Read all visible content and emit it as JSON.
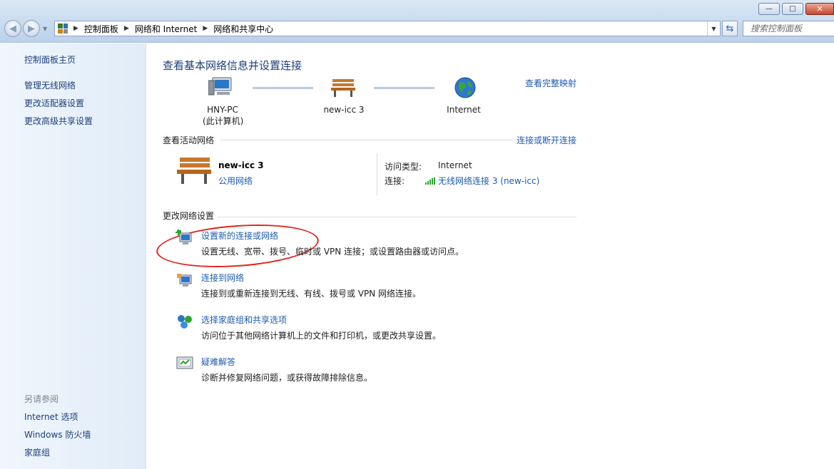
{
  "window": {
    "minimize_glyph": "—",
    "maximize_glyph": "□",
    "close_glyph": "✕"
  },
  "address_bar": {
    "crumbs": [
      "控制面板",
      "网络和 Internet",
      "网络和共享中心"
    ],
    "search_placeholder": "搜索控制面板"
  },
  "sidebar": {
    "home": "控制面板主页",
    "links": [
      "管理无线网络",
      "更改适配器设置",
      "更改高级共享设置"
    ],
    "see_also_title": "另请参阅",
    "see_also": [
      "Internet 选项",
      "Windows 防火墙",
      "家庭组"
    ]
  },
  "main": {
    "title": "查看基本网络信息并设置连接",
    "full_map_link": "查看完整映射",
    "map": {
      "computer_name": "HNY-PC",
      "computer_sub": "(此计算机)",
      "network_name": "new-icc  3",
      "internet_label": "Internet"
    },
    "active_networks": {
      "title": "查看活动网络",
      "connect_link": "连接或断开连接",
      "network_name": "new-icc  3",
      "network_type": "公用网络",
      "access_type_label": "访问类型:",
      "access_type_value": "Internet",
      "connection_label": "连接:",
      "connection_value": "无线网络连接 3 (new-icc)"
    },
    "change_settings": {
      "title": "更改网络设置",
      "tasks": [
        {
          "title": "设置新的连接或网络",
          "desc": "设置无线、宽带、拨号、临时或 VPN 连接；或设置路由器或访问点。"
        },
        {
          "title": "连接到网络",
          "desc": "连接到或重新连接到无线、有线、拨号或 VPN 网络连接。"
        },
        {
          "title": "选择家庭组和共享选项",
          "desc": "访问位于其他网络计算机上的文件和打印机，或更改共享设置。"
        },
        {
          "title": "疑难解答",
          "desc": "诊断并修复网络问题，或获得故障排除信息。"
        }
      ]
    }
  },
  "colors": {
    "link": "#1e5bb0",
    "title": "#1e3e7b",
    "annotation_circle": "#e0261f"
  }
}
